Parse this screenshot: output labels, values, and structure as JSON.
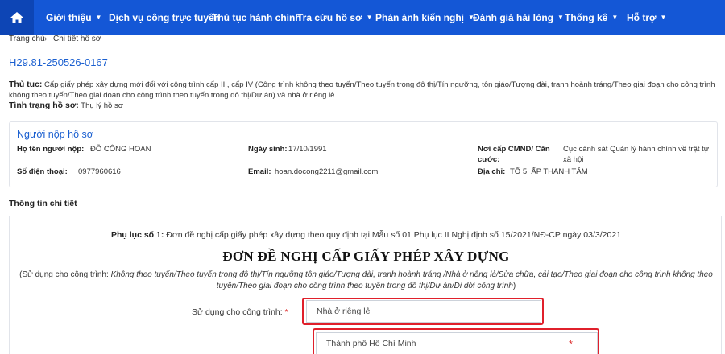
{
  "nav": {
    "items": [
      {
        "label": "Giới thiệu",
        "caret": true
      },
      {
        "label": "Dịch vụ công trực tuyến",
        "caret": false
      },
      {
        "label": "Thủ tục hành chính",
        "caret": false
      },
      {
        "label": "Tra cứu hồ sơ",
        "caret": true
      },
      {
        "label": "Phản ánh kiến nghị",
        "caret": true
      },
      {
        "label": "Đánh giá hài lòng",
        "caret": true
      },
      {
        "label": "Thống kê",
        "caret": true
      },
      {
        "label": "Hỗ trợ",
        "caret": true
      }
    ],
    "home_icon": "home-icon",
    "colors": {
      "bar": "#1457d6",
      "home": "#0d45b5"
    }
  },
  "breadcrumb": {
    "home": "Trang chủ",
    "separator": "›",
    "current": "Chi tiết hồ sơ"
  },
  "case_code": "H29.81-250526-0167",
  "procedure": {
    "label": "Thủ tục:",
    "text": "Cấp giấy phép xây dựng mới đối với công trình cấp III, cấp IV (Công trình không theo tuyến/Theo tuyến trong đô thị/Tín ngưỡng, tôn giáo/Tượng đài, tranh hoành tráng/Theo giai đoạn cho công trình không theo tuyến/Theo giai đoạn cho công trình theo tuyến trong đô thị/Dự án) và nhà ở riêng lẻ"
  },
  "status": {
    "label": "Tình trạng hồ sơ:",
    "value": "Thụ lý hồ sơ"
  },
  "submitter": {
    "title": "Người nộp hồ sơ",
    "name_label": "Họ tên người nộp:",
    "name": "ĐỖ CÔNG HOAN",
    "dob_label": "Ngày sinh:",
    "dob": "17/10/1991",
    "issuer_label": "Nơi cấp CMND/ Căn cước:",
    "issuer": "Cục cảnh sát Quản lý hành chính về trật tự xã hội",
    "phone_label": "Số điện thoại:",
    "phone": "0977960616",
    "email_label": "Email:",
    "email": "hoan.docong2211@gmail.com",
    "address_label": "Địa chỉ:",
    "address": "TỔ 5, ẤP THANH TÂM"
  },
  "detail": {
    "title": "Thông tin chi tiết",
    "appendix_label": "Phụ lục số 1:",
    "appendix_text": "Đơn đề nghị cấp giấy phép xây dựng theo quy định tại Mẫu số 01 Phụ lục II Nghị định số 15/2021/NĐ-CP ngày 03/3/2021",
    "form_title": "ĐƠN ĐỀ NGHỊ CẤP GIẤY PHÉP XÂY DỰNG",
    "note_prefix": "(Sử dụng cho công trình: ",
    "note_italic": "Không theo tuyến/Theo tuyến trong đô thị/Tín ngưỡng tôn giáo/Tượng đài, tranh hoành tráng /Nhà ở riêng lẻ/Sửa chữa, cải tạo/Theo giai đoạn cho công trình không theo tuyến/Theo giai đoạn cho công trình theo tuyến trong đô thị/Dự án/Di dời công trình",
    "note_suffix": ")",
    "usage_label": "Sử dụng cho công trình:",
    "required_mark": "*",
    "usage_value": "Nhà ở riêng lẻ",
    "city_value": "Thành phố Hồ Chí Minh",
    "highlight_color": "#e0202b"
  }
}
